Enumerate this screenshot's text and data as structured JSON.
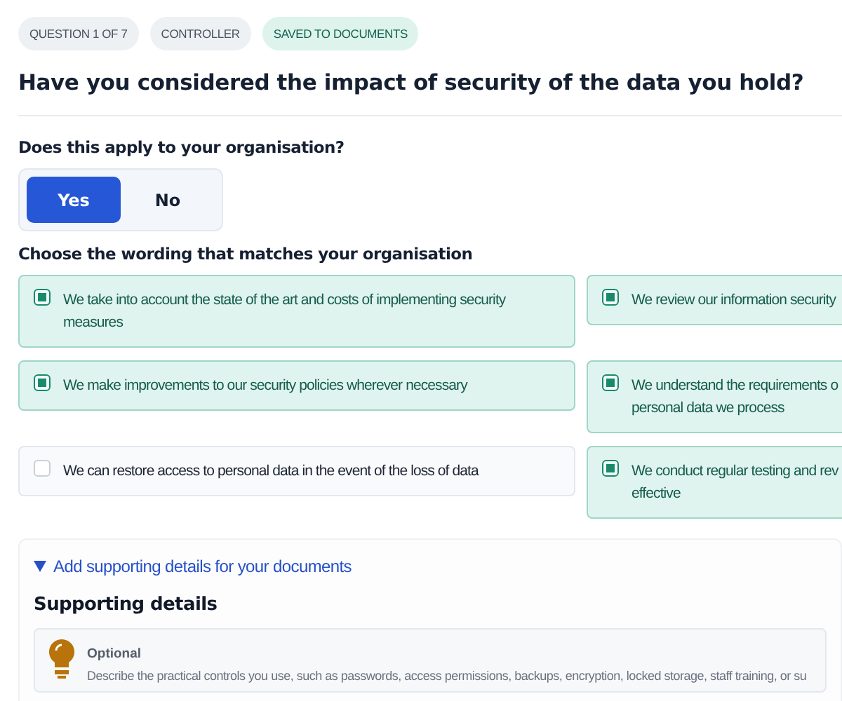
{
  "badges": [
    {
      "label": "QUESTION 1 OF 7",
      "kind": "neutral"
    },
    {
      "label": "CONTROLLER",
      "kind": "neutral"
    },
    {
      "label": "SAVED TO DOCUMENTS",
      "kind": "success"
    }
  ],
  "question": "Have you considered the impact of security of the data you hold?",
  "applies": {
    "label": "Does this apply to your organisation?",
    "options": [
      {
        "label": "Yes",
        "selected": true
      },
      {
        "label": "No",
        "selected": false
      }
    ]
  },
  "wording": {
    "label": "Choose the wording that matches your organisation",
    "options": [
      {
        "lines": [
          "We take into account the state of the art and costs of implementing security",
          "measures"
        ],
        "checked": true
      },
      {
        "lines": [
          "We review our information security"
        ],
        "checked": true
      },
      {
        "lines": [
          "We make improvements to our security policies wherever necessary"
        ],
        "checked": true
      },
      {
        "lines": [
          "We understand the requirements o",
          "personal data we process"
        ],
        "checked": true
      },
      {
        "lines": [
          "We can restore access to personal data in the event of the loss of data"
        ],
        "checked": false
      },
      {
        "lines": [
          "We conduct regular testing and rev",
          "effective"
        ],
        "checked": true
      }
    ]
  },
  "details": {
    "toggle": "Add supporting details for your documents",
    "expanded": true,
    "title": "Supporting details",
    "tip_title": "Optional",
    "tip_text": "Describe the practical controls you use, such as passwords, access permissions, backups, encryption, locked storage, staff training, or su"
  }
}
